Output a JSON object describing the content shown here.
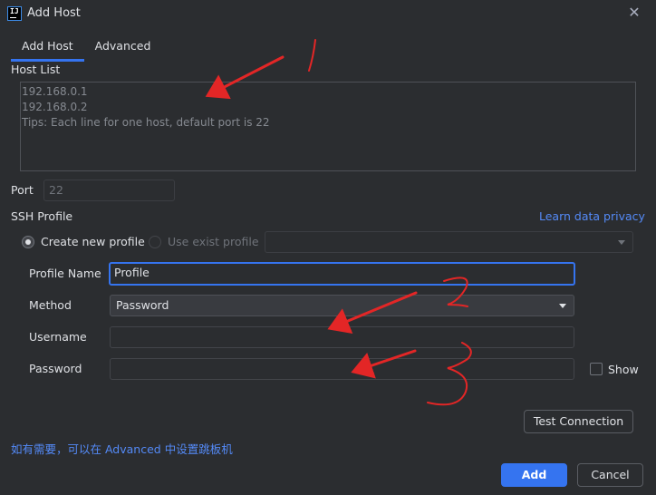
{
  "window": {
    "title": "Add Host",
    "app_icon_text": "IJ"
  },
  "tabs": [
    {
      "label": "Add Host",
      "active": true
    },
    {
      "label": "Advanced",
      "active": false
    }
  ],
  "host_list": {
    "label": "Host List",
    "lines": [
      "192.168.0.1",
      "192.168.0.2",
      "Tips: Each line for one host, default port is 22"
    ]
  },
  "port": {
    "label": "Port",
    "value": "22"
  },
  "ssh_profile": {
    "label": "SSH Profile",
    "privacy_link": "Learn data privacy",
    "create_new_label": "Create new profile",
    "use_exist_label": "Use exist profile",
    "exist_select_value": ""
  },
  "form": {
    "profile_name_label": "Profile Name",
    "profile_name_value": "Profile",
    "method_label": "Method",
    "method_value": "Password",
    "username_label": "Username",
    "username_value": "",
    "password_label": "Password",
    "password_value": "",
    "show_label": "Show"
  },
  "test_connection_label": "Test Connection",
  "hint_text": "如有需要，可以在 Advanced 中设置跳板机",
  "footer": {
    "add_label": "Add",
    "cancel_label": "Cancel"
  },
  "colors": {
    "background": "#2b2d30",
    "accent": "#3574f0",
    "link": "#548af7",
    "annotation": "#e32626"
  }
}
